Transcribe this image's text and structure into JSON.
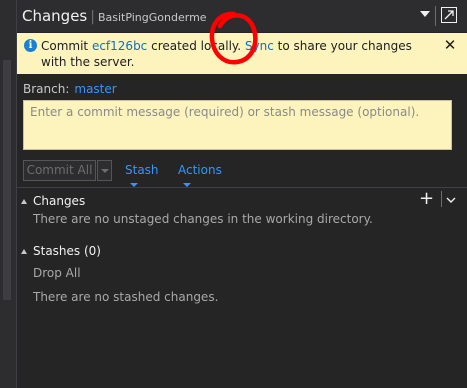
{
  "title": {
    "main": "Changes",
    "separator": "|",
    "repo": "BasitPingGonderme"
  },
  "infobar": {
    "icon": "info-icon",
    "prefix": "Commit ",
    "commit_link": "ecf126bc",
    "middle": " created locally. ",
    "sync_link": "Sync",
    "suffix": " to share your changes with the server.",
    "close_icon": "close-icon"
  },
  "branch": {
    "label": "Branch:",
    "value": "master"
  },
  "commit": {
    "placeholder": "Enter a commit message (required) or stash message (optional)."
  },
  "actions": {
    "commit_all": "Commit All",
    "stash": "Stash",
    "actions": "Actions"
  },
  "changes": {
    "header": "Changes",
    "empty_message": "There are no unstaged changes in the working directory."
  },
  "stashes": {
    "header": "Stashes (0)",
    "drop_all": "Drop All",
    "empty_message": "There are no stashed changes."
  },
  "colors": {
    "accent": "#3794ff",
    "infobar_bg": "#fcf3bd",
    "annotation": "#ff0000"
  }
}
